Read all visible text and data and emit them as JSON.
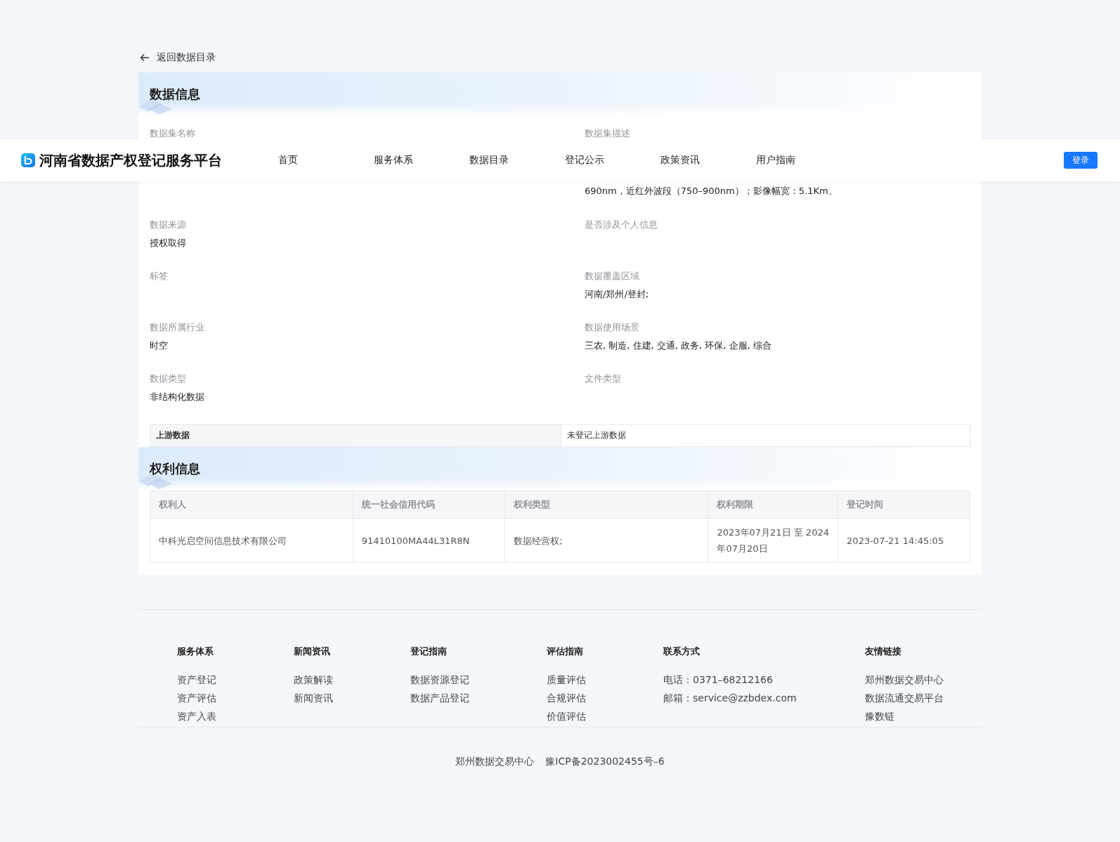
{
  "header": {
    "title": "河南省数据产权登记服务平台",
    "nav": [
      {
        "label": "首页",
        "selected": false
      },
      {
        "label": "服务体系",
        "selected": false
      },
      {
        "label": "数据目录",
        "selected": false
      },
      {
        "label": "登记公示",
        "selected": false
      },
      {
        "label": "政策资讯",
        "selected": false
      },
      {
        "label": "用户指南",
        "selected": false
      }
    ],
    "login": "登录"
  },
  "back_link": "返回数据目录",
  "data_info": {
    "title": "数据信息",
    "fields": [
      {
        "label": "数据集名称"
      },
      {
        "label": "数据集描述",
        "value": "690nm，近红外波段（750–900nm）；影像幅宽：5.1Km。"
      },
      {
        "label": "数据来源",
        "value": "授权取得"
      },
      {
        "label": "是否涉及个人信息"
      },
      {
        "label": "标签"
      },
      {
        "label": "数据覆盖区域",
        "value": "河南/郑州/登封;"
      },
      {
        "label": "数据所属行业",
        "value": "时空"
      },
      {
        "label": "数据使用场景",
        "value": "三农, 制造, 住建, 交通, 政务, 环保, 企服, 综合"
      },
      {
        "label": "数据类型",
        "value": "非结构化数据"
      },
      {
        "label": "文件类型"
      }
    ],
    "upstream": {
      "label": "上游数据",
      "value": "未登记上游数据"
    }
  },
  "rights_info": {
    "title": "权利信息",
    "columns": [
      "权利人",
      "统一社会信用代码",
      "权利类型",
      "权利期限",
      "登记时间"
    ],
    "rows": [
      [
        "中科光启空间信息技术有限公司",
        "91410100MA44L31R8N",
        "数据经营权;",
        "2023年07月21日 至 2024年07月20日",
        "2023-07-21 14:45:05"
      ]
    ]
  },
  "footer": {
    "columns": [
      {
        "title": "服务体系",
        "links": [
          "资产登记",
          "资产评估",
          "资产入表"
        ]
      },
      {
        "title": "新闻资讯",
        "links": [
          "政策解读",
          "新闻资讯"
        ]
      },
      {
        "title": "登记指南",
        "links": [
          "数据资源登记",
          "数据产品登记"
        ]
      },
      {
        "title": "评估指南",
        "links": [
          "质量评估",
          "合规评估",
          "价值评估"
        ]
      },
      {
        "title": "联系方式",
        "links": [
          "电话：0371–68212166",
          "邮箱：service@zzbdex.com"
        ]
      },
      {
        "title": "友情链接",
        "links": [
          "郑州数据交易中心",
          "数据流通交易平台",
          "豫数链"
        ]
      }
    ],
    "bottom": [
      "郑州数据交易中心",
      "豫ICP备2023002455号–6"
    ]
  }
}
